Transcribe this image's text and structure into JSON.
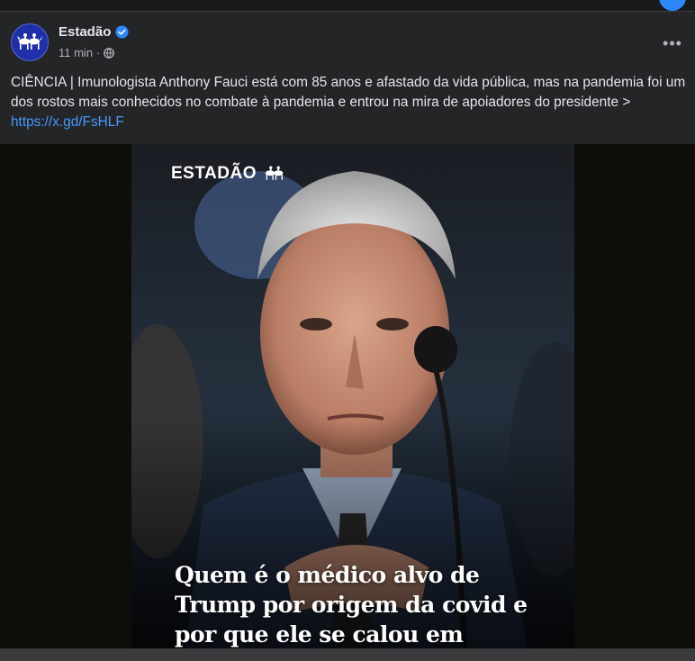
{
  "post": {
    "page_name": "Estadão",
    "time": "11 min",
    "separator": "·",
    "text_prefix": "CIÊNCIA | Imunologista Anthony Fauci está com 85 anos e afastado da vida pública, mas na pandemia foi um dos rostos mais conhecidos no combate à pandemia e entrou na mira de apoiadores do presidente > ",
    "link": "https://x.gd/FsHLF",
    "more_label": "•••"
  },
  "media": {
    "watermark": "ESTADÃO",
    "headline": "Quem é o médico alvo de Trump por origem da covid e por que ele se calou em depoimento"
  },
  "icons": {
    "avatar": "estadao-horses-logo",
    "verified": "verified-badge-icon",
    "audience": "globe-icon",
    "more": "more-options-icon"
  },
  "colors": {
    "background": "#242526",
    "link": "#4599ff",
    "verified": "#2d88ff"
  }
}
